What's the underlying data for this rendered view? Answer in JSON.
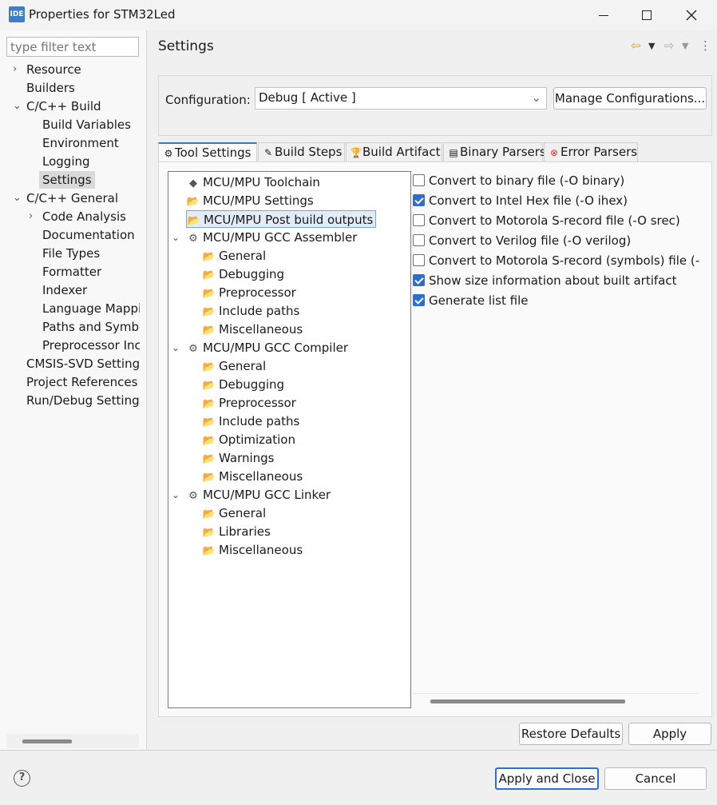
{
  "window": {
    "title": "Properties for STM32Led",
    "app_icon": "IDE"
  },
  "left": {
    "filter_placeholder": "type filter text",
    "items": [
      {
        "label": "Resource",
        "chevron": "›"
      },
      {
        "label": "Builders",
        "chevron": ""
      },
      {
        "label": "C/C++ Build",
        "chevron": "⌄"
      },
      {
        "label": "Build Variables",
        "chevron": ""
      },
      {
        "label": "Environment",
        "chevron": ""
      },
      {
        "label": "Logging",
        "chevron": ""
      },
      {
        "label": "Settings",
        "chevron": ""
      },
      {
        "label": "C/C++ General",
        "chevron": "⌄"
      },
      {
        "label": "Code Analysis",
        "chevron": "›"
      },
      {
        "label": "Documentation",
        "chevron": ""
      },
      {
        "label": "File Types",
        "chevron": ""
      },
      {
        "label": "Formatter",
        "chevron": ""
      },
      {
        "label": "Indexer",
        "chevron": ""
      },
      {
        "label": "Language Mappi",
        "chevron": ""
      },
      {
        "label": "Paths and Symbo",
        "chevron": ""
      },
      {
        "label": "Preprocessor Inc",
        "chevron": ""
      },
      {
        "label": "CMSIS-SVD Setting",
        "chevron": ""
      },
      {
        "label": "Project References",
        "chevron": ""
      },
      {
        "label": "Run/Debug Setting",
        "chevron": ""
      }
    ]
  },
  "right": {
    "title": "Settings",
    "config_label": "Configuration:",
    "config_value": "Debug  [ Active ]",
    "manage_label": "Manage Configurations...",
    "tabs": [
      {
        "label": "Tool Settings",
        "icon": "⚙"
      },
      {
        "label": "Build Steps",
        "icon": "✎"
      },
      {
        "label": "Build Artifact",
        "icon": "🏆"
      },
      {
        "label": "Binary Parsers",
        "icon": "▤"
      },
      {
        "label": "Error Parsers",
        "icon": "⊗"
      }
    ],
    "tool_tree": [
      {
        "label": "MCU/MPU Toolchain",
        "icon": "◆",
        "chevron": ""
      },
      {
        "label": "MCU/MPU Settings",
        "icon": "📂",
        "chevron": ""
      },
      {
        "label": "MCU/MPU Post build outputs",
        "icon": "📂",
        "chevron": ""
      },
      {
        "label": "MCU/MPU GCC Assembler",
        "icon": "⚙",
        "chevron": "⌄"
      },
      {
        "label": "General",
        "icon": "📂",
        "chevron": ""
      },
      {
        "label": "Debugging",
        "icon": "📂",
        "chevron": ""
      },
      {
        "label": "Preprocessor",
        "icon": "📂",
        "chevron": ""
      },
      {
        "label": "Include paths",
        "icon": "📂",
        "chevron": ""
      },
      {
        "label": "Miscellaneous",
        "icon": "📂",
        "chevron": ""
      },
      {
        "label": "MCU/MPU GCC Compiler",
        "icon": "⚙",
        "chevron": "⌄"
      },
      {
        "label": "General",
        "icon": "📂",
        "chevron": ""
      },
      {
        "label": "Debugging",
        "icon": "📂",
        "chevron": ""
      },
      {
        "label": "Preprocessor",
        "icon": "📂",
        "chevron": ""
      },
      {
        "label": "Include paths",
        "icon": "📂",
        "chevron": ""
      },
      {
        "label": "Optimization",
        "icon": "📂",
        "chevron": ""
      },
      {
        "label": "Warnings",
        "icon": "📂",
        "chevron": ""
      },
      {
        "label": "Miscellaneous",
        "icon": "📂",
        "chevron": ""
      },
      {
        "label": "MCU/MPU GCC Linker",
        "icon": "⚙",
        "chevron": "⌄"
      },
      {
        "label": "General",
        "icon": "📂",
        "chevron": ""
      },
      {
        "label": "Libraries",
        "icon": "📂",
        "chevron": ""
      },
      {
        "label": "Miscellaneous",
        "icon": "📂",
        "chevron": ""
      }
    ],
    "options": [
      {
        "label": "Convert to binary file (-O binary)",
        "checked": false
      },
      {
        "label": "Convert to Intel Hex file (-O ihex)",
        "checked": true
      },
      {
        "label": "Convert to Motorola S-record file (-O srec)",
        "checked": false
      },
      {
        "label": "Convert to Verilog file (-O verilog)",
        "checked": false
      },
      {
        "label": "Convert to Motorola S-record (symbols) file (-O symbolsrec)",
        "checked": false
      },
      {
        "label": "Show size information about built artifact",
        "checked": true
      },
      {
        "label": "Generate list file",
        "checked": true
      }
    ],
    "restore_label": "Restore Defaults",
    "apply_label": "Apply"
  },
  "footer": {
    "help": "?",
    "apply_close_label": "Apply and Close",
    "cancel_label": "Cancel"
  },
  "colors": {
    "accent": "#2b6fcf",
    "selection": "#e1ecf8"
  }
}
